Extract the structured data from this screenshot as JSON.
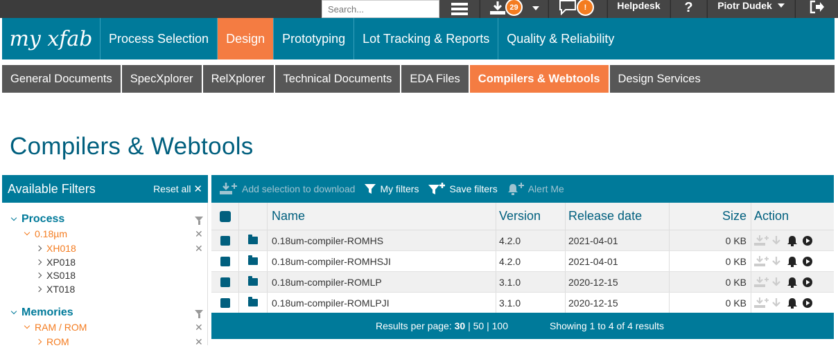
{
  "topbar": {
    "search_placeholder": "Search...",
    "downloads_count": "29",
    "notifications_badge": "!",
    "helpdesk": "Helpdesk",
    "help_glyph": "?",
    "user_name": "Piotr Dudek"
  },
  "brand": {
    "logo_text": "my xfab"
  },
  "main_nav": [
    {
      "label": "Process Selection"
    },
    {
      "label": "Design"
    },
    {
      "label": "Prototyping"
    },
    {
      "label": "Lot Tracking & Reports"
    },
    {
      "label": "Quality & Reliability"
    }
  ],
  "sub_nav": [
    {
      "label": "General Documents"
    },
    {
      "label": "SpecXplorer"
    },
    {
      "label": "RelXplorer"
    },
    {
      "label": "Technical Documents"
    },
    {
      "label": "EDA Files"
    },
    {
      "label": "Compilers & Webtools"
    },
    {
      "label": "Design Services"
    }
  ],
  "page_title": "Compilers & Webtools",
  "filters": {
    "title": "Available Filters",
    "reset": "Reset all",
    "process": "Process",
    "process_sel": "0.18µm",
    "xh018": "XH018",
    "xp018": "XP018",
    "xs018": "XS018",
    "xt018": "XT018",
    "memories": "Memories",
    "ramrom": "RAM / ROM",
    "rom": "ROM"
  },
  "toolbar": {
    "add_selection": "Add selection to download",
    "my_filters": "My filters",
    "save_filters": "Save filters",
    "alert_me": "Alert Me"
  },
  "table": {
    "headers": {
      "name": "Name",
      "version": "Version",
      "release_date": "Release date",
      "size": "Size",
      "action": "Action"
    },
    "rows": [
      {
        "name": "0.18um-compiler-ROMHS",
        "version": "4.2.0",
        "date": "2021-04-01",
        "size": "0 KB"
      },
      {
        "name": "0.18um-compiler-ROMHSJI",
        "version": "4.2.0",
        "date": "2021-04-01",
        "size": "0 KB"
      },
      {
        "name": "0.18um-compiler-ROMLP",
        "version": "3.1.0",
        "date": "2020-12-15",
        "size": "0 KB"
      },
      {
        "name": "0.18um-compiler-ROMLPJI",
        "version": "3.1.0",
        "date": "2020-12-15",
        "size": "0 KB"
      }
    ]
  },
  "pagination": {
    "label": "Results per page:",
    "opt_30": "30",
    "opt_50": "50",
    "opt_100": "100",
    "sep": "|",
    "showing": "Showing 1 to 4 of 4 results"
  },
  "colors": {
    "primary": "#007a9a",
    "accent": "#f47c42",
    "dark": "#3c3c3c",
    "subnav": "#575757"
  }
}
